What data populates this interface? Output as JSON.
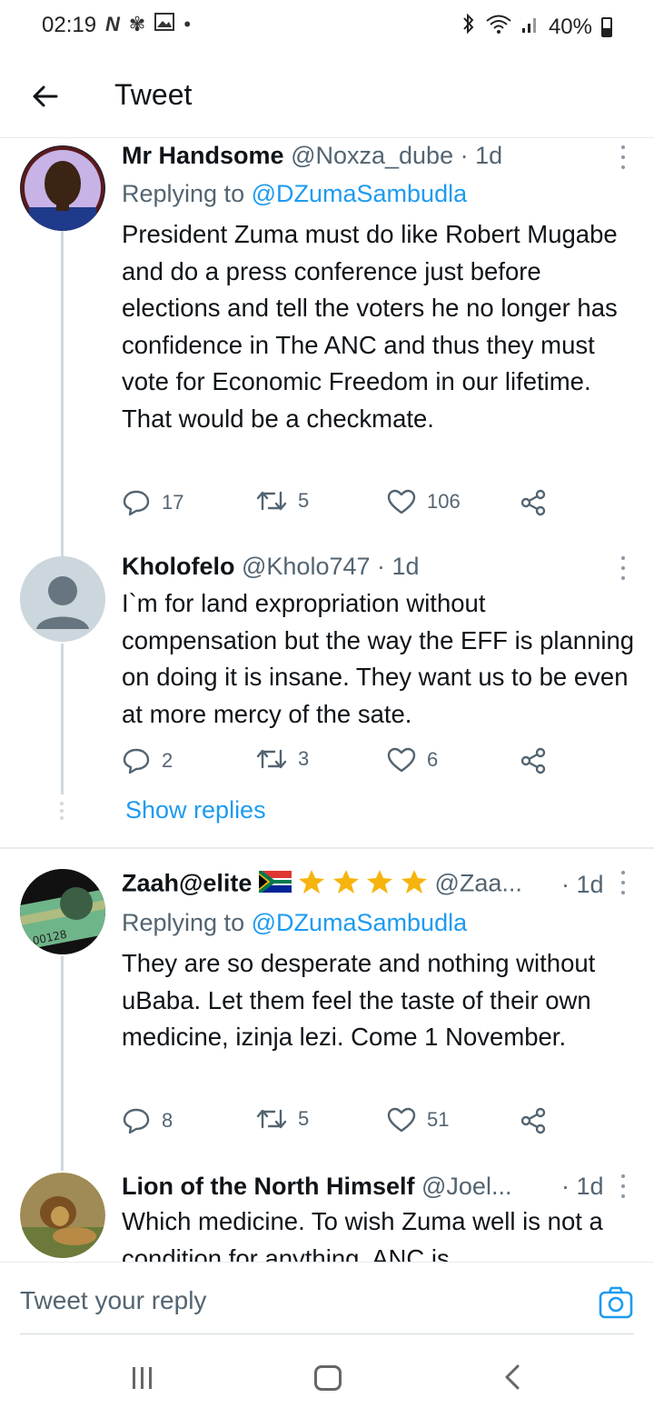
{
  "status_bar": {
    "time": "02:19",
    "battery": "40%"
  },
  "header": {
    "title": "Tweet"
  },
  "tweets": [
    {
      "name": "Mr Handsome",
      "handle": "@Noxza_dube · 1d",
      "replying_prefix": "Replying to ",
      "replying_mention": "@DZumaSambudla",
      "text": "President Zuma must do like Robert Mugabe and do a press conference just before elections and tell the voters he no longer has confidence in The ANC and thus they must vote for Economic Freedom in our lifetime. That would be a checkmate.",
      "replies": "17",
      "retweets": "5",
      "likes": "106"
    },
    {
      "name": "Kholofelo",
      "handle": "@Kholo747 · 1d",
      "text": "I`m for land expropriation without compensation but the way the EFF is planning on doing it is insane. They want us to be even at more mercy of the sate.",
      "replies": "2",
      "retweets": "3",
      "likes": "6"
    },
    {
      "name": "Zaah@elite",
      "handle": "@Zaa...",
      "time": "· 1d",
      "replying_prefix": "Replying to ",
      "replying_mention": "@DZumaSambudla",
      "text": "They are so desperate and nothing without uBaba. Let them feel the taste of their own medicine, izinja lezi. Come 1 November.",
      "replies": "8",
      "retweets": "5",
      "likes": "51"
    },
    {
      "name": "Lion of the North Himself",
      "handle": "@Joel...",
      "time": "· 1d",
      "text": "Which medicine. To wish Zuma well is not a condition for anything. ANC is"
    }
  ],
  "show_replies": "Show replies",
  "reply_bar": {
    "placeholder": "Tweet your reply"
  },
  "colors": {
    "accent": "#1d9bf0",
    "secondary_text": "#536471",
    "primary_text": "#0f1419",
    "star": "#f6b40e"
  }
}
